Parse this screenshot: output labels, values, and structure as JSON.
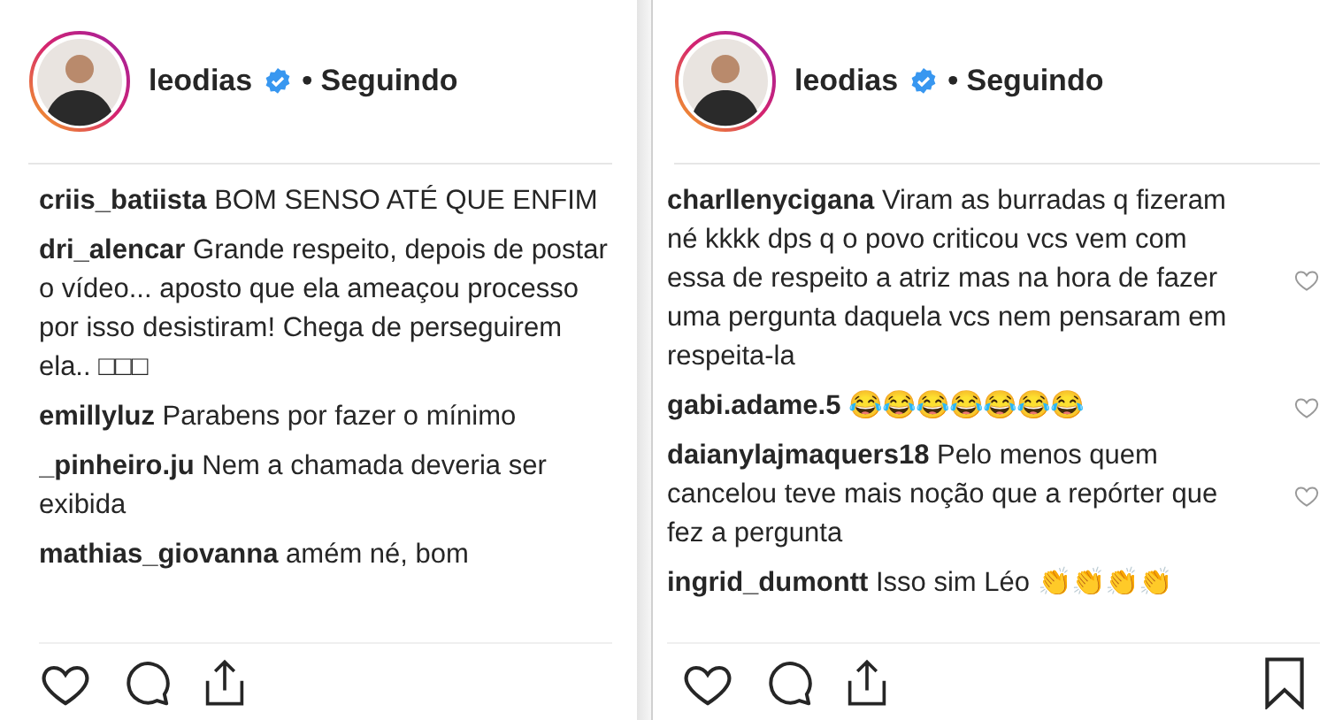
{
  "panels": [
    {
      "account": {
        "username": "leodias",
        "verified": true,
        "follow_status": "• Seguindo"
      },
      "comments": [
        {
          "username": "criis_batiista",
          "text": "BOM SENSO ATÉ QUE ENFIM",
          "like_button": false
        },
        {
          "username": "dri_alencar",
          "text": "Grande respeito, depois de postar o vídeo... aposto que ela ameaçou processo por isso desistiram! Chega de perseguirem ela.. □□□",
          "like_button": false
        },
        {
          "username": "emillyluz",
          "text": "Parabens por fazer o mínimo",
          "like_button": false
        },
        {
          "username": "_pinheiro.ju",
          "text": "Nem a chamada deveria ser exibida",
          "like_button": false
        },
        {
          "username": "mathias_giovanna",
          "text": "amém né, bom",
          "like_button": false
        }
      ],
      "bookmark": false
    },
    {
      "account": {
        "username": "leodias",
        "verified": true,
        "follow_status": "• Seguindo"
      },
      "comments": [
        {
          "username": "charllenycigana",
          "text": "Viram as burradas q fizeram né kkkk dps q o povo criticou vcs vem com essa de respeito a atriz mas na hora de fazer uma pergunta daquela vcs nem pensaram em respeita-la",
          "like_button": true
        },
        {
          "username": "gabi.adame.5",
          "text": "😂😂😂😂😂😂😂",
          "like_button": true
        },
        {
          "username": "daianylajmaquers18",
          "text": "Pelo menos quem cancelou teve mais noção que a repórter que fez a pergunta",
          "like_button": true
        },
        {
          "username": "ingrid_dumontt",
          "text": "Isso sim Léo 👏👏👏👏",
          "like_button": false
        }
      ],
      "bookmark": true
    }
  ]
}
